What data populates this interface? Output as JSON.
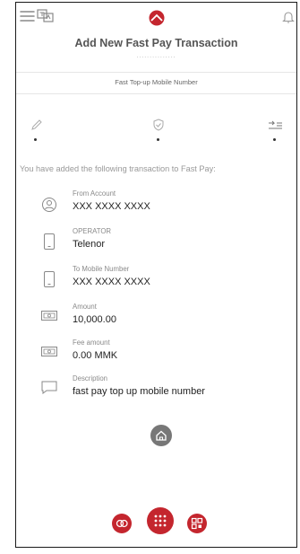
{
  "header": {
    "title": "Add New Fast Pay Transaction",
    "subtitle_dots": "..............."
  },
  "tab": {
    "label": "Fast Top-up Mobile Number"
  },
  "steps": [
    "pencil-icon",
    "shield-check-icon",
    "list-arrow-icon"
  ],
  "intro": "You have added the following transaction to Fast Pay:",
  "details": [
    {
      "icon": "user-circle-icon",
      "label": "From Account",
      "value": "XXX XXXX XXXX"
    },
    {
      "icon": "phone-icon",
      "label": "OPERATOR",
      "value": "Telenor"
    },
    {
      "icon": "phone-icon",
      "label": "To Mobile Number",
      "value": " XXX XXXX XXXX"
    },
    {
      "icon": "banknote-icon",
      "label": "Amount",
      "value": "10,000.00"
    },
    {
      "icon": "banknote-icon",
      "label": "Fee amount",
      "value": "0.00 MMK"
    },
    {
      "icon": "speech-bubble-icon",
      "label": "Description",
      "value": "fast pay top up mobile number"
    }
  ],
  "colors": {
    "brand": "#c4262e",
    "home": "#777777",
    "muted": "#999999"
  },
  "bottom_nav": [
    "chart-icon",
    "grid-icon",
    "qr-icon"
  ]
}
